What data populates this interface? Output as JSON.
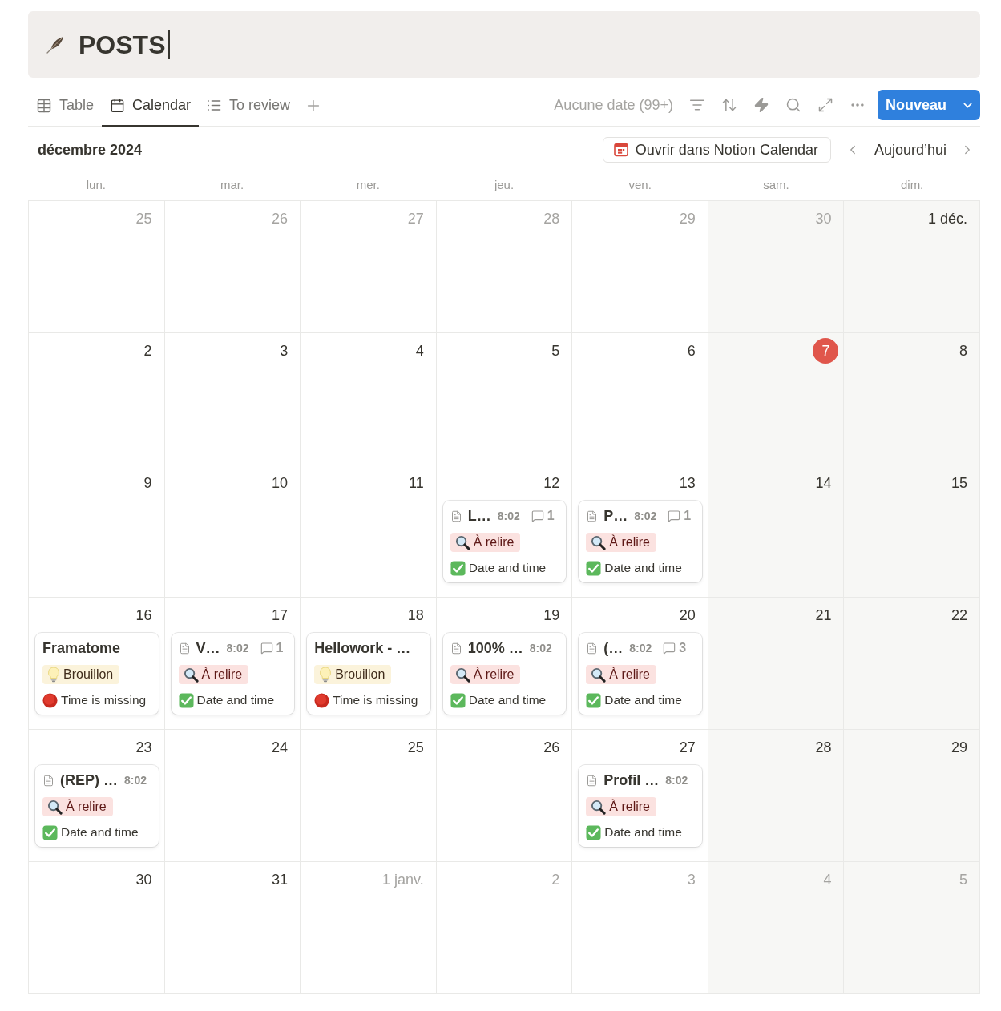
{
  "page": {
    "title": "POSTS"
  },
  "views": {
    "tabs": [
      {
        "label": "Table",
        "kind": "table",
        "selected": false
      },
      {
        "label": "Calendar",
        "kind": "calendar",
        "selected": true
      },
      {
        "label": "To review",
        "kind": "list",
        "selected": false
      }
    ]
  },
  "toolbar": {
    "no_date": "Aucune date (99+)",
    "new_button": "Nouveau"
  },
  "calendar": {
    "month": "décembre 2024",
    "open_button": "Ouvrir dans Notion Calendar",
    "today_button": "Aujourd’hui",
    "weekdays": [
      "lun.",
      "mar.",
      "mer.",
      "jeu.",
      "ven.",
      "sam.",
      "dim."
    ],
    "weeks": [
      [
        {
          "label": "25",
          "in_month": false,
          "today": false
        },
        {
          "label": "26",
          "in_month": false,
          "today": false
        },
        {
          "label": "27",
          "in_month": false,
          "today": false
        },
        {
          "label": "28",
          "in_month": false,
          "today": false
        },
        {
          "label": "29",
          "in_month": false,
          "today": false
        },
        {
          "label": "30",
          "in_month": false,
          "today": false
        },
        {
          "label": "1 déc.",
          "in_month": true,
          "today": false
        }
      ],
      [
        {
          "label": "2",
          "in_month": true,
          "today": false
        },
        {
          "label": "3",
          "in_month": true,
          "today": false
        },
        {
          "label": "4",
          "in_month": true,
          "today": false
        },
        {
          "label": "5",
          "in_month": true,
          "today": false
        },
        {
          "label": "6",
          "in_month": true,
          "today": false
        },
        {
          "label": "7",
          "in_month": true,
          "today": true
        },
        {
          "label": "8",
          "in_month": true,
          "today": false
        }
      ],
      [
        {
          "label": "9",
          "in_month": true,
          "today": false
        },
        {
          "label": "10",
          "in_month": true,
          "today": false
        },
        {
          "label": "11",
          "in_month": true,
          "today": false
        },
        {
          "label": "12",
          "in_month": true,
          "today": false,
          "cards": [
            {
              "kind": "page",
              "title": "L…",
              "time": "8:02",
              "comments": "1",
              "tag": {
                "label": "À relire",
                "kind": "review"
              },
              "property": {
                "text": "Date and time",
                "kind": "ok"
              }
            }
          ]
        },
        {
          "label": "13",
          "in_month": true,
          "today": false,
          "cards": [
            {
              "kind": "page",
              "title": "P…",
              "time": "8:02",
              "comments": "1",
              "tag": {
                "label": "À relire",
                "kind": "review"
              },
              "property": {
                "text": "Date and time",
                "kind": "ok"
              }
            }
          ]
        },
        {
          "label": "14",
          "in_month": true,
          "today": false
        },
        {
          "label": "15",
          "in_month": true,
          "today": false
        }
      ],
      [
        {
          "label": "16",
          "in_month": true,
          "today": false,
          "cards": [
            {
              "kind": "plain",
              "title": "Framatome",
              "tag": {
                "label": "Brouillon",
                "kind": "draft"
              },
              "property": {
                "text": "Time is missing",
                "kind": "missing"
              }
            }
          ]
        },
        {
          "label": "17",
          "in_month": true,
          "today": false,
          "cards": [
            {
              "kind": "page",
              "title": "V…",
              "time": "8:02",
              "comments": "1",
              "tag": {
                "label": "À relire",
                "kind": "review"
              },
              "property": {
                "text": "Date and time",
                "kind": "ok"
              }
            }
          ]
        },
        {
          "label": "18",
          "in_month": true,
          "today": false,
          "cards": [
            {
              "kind": "plain",
              "title": "Hellowork - …",
              "tag": {
                "label": "Brouillon",
                "kind": "draft"
              },
              "property": {
                "text": "Time is missing",
                "kind": "missing"
              }
            }
          ]
        },
        {
          "label": "19",
          "in_month": true,
          "today": false,
          "cards": [
            {
              "kind": "page",
              "title": "100% …",
              "time": "8:02",
              "tag": {
                "label": "À relire",
                "kind": "review"
              },
              "property": {
                "text": "Date and time",
                "kind": "ok"
              }
            }
          ]
        },
        {
          "label": "20",
          "in_month": true,
          "today": false,
          "cards": [
            {
              "kind": "page",
              "title": "(…",
              "time": "8:02",
              "comments": "3",
              "tag": {
                "label": "À relire",
                "kind": "review"
              },
              "property": {
                "text": "Date and time",
                "kind": "ok"
              }
            }
          ]
        },
        {
          "label": "21",
          "in_month": true,
          "today": false
        },
        {
          "label": "22",
          "in_month": true,
          "today": false
        }
      ],
      [
        {
          "label": "23",
          "in_month": true,
          "today": false,
          "cards": [
            {
              "kind": "page",
              "title": "(REP) …",
              "time": "8:02",
              "tag": {
                "label": "À relire",
                "kind": "review"
              },
              "property": {
                "text": "Date and time",
                "kind": "ok"
              }
            }
          ]
        },
        {
          "label": "24",
          "in_month": true,
          "today": false
        },
        {
          "label": "25",
          "in_month": true,
          "today": false
        },
        {
          "label": "26",
          "in_month": true,
          "today": false
        },
        {
          "label": "27",
          "in_month": true,
          "today": false,
          "cards": [
            {
              "kind": "page",
              "title": "Profil …",
              "time": "8:02",
              "tag": {
                "label": "À relire",
                "kind": "review"
              },
              "property": {
                "text": "Date and time",
                "kind": "ok"
              }
            }
          ]
        },
        {
          "label": "28",
          "in_month": true,
          "today": false
        },
        {
          "label": "29",
          "in_month": true,
          "today": false
        }
      ],
      [
        {
          "label": "30",
          "in_month": true,
          "today": false
        },
        {
          "label": "31",
          "in_month": true,
          "today": false
        },
        {
          "label": "1 janv.",
          "in_month": false,
          "today": false
        },
        {
          "label": "2",
          "in_month": false,
          "today": false
        },
        {
          "label": "3",
          "in_month": false,
          "today": false
        },
        {
          "label": "4",
          "in_month": false,
          "today": false
        },
        {
          "label": "5",
          "in_month": false,
          "today": false
        }
      ]
    ]
  }
}
